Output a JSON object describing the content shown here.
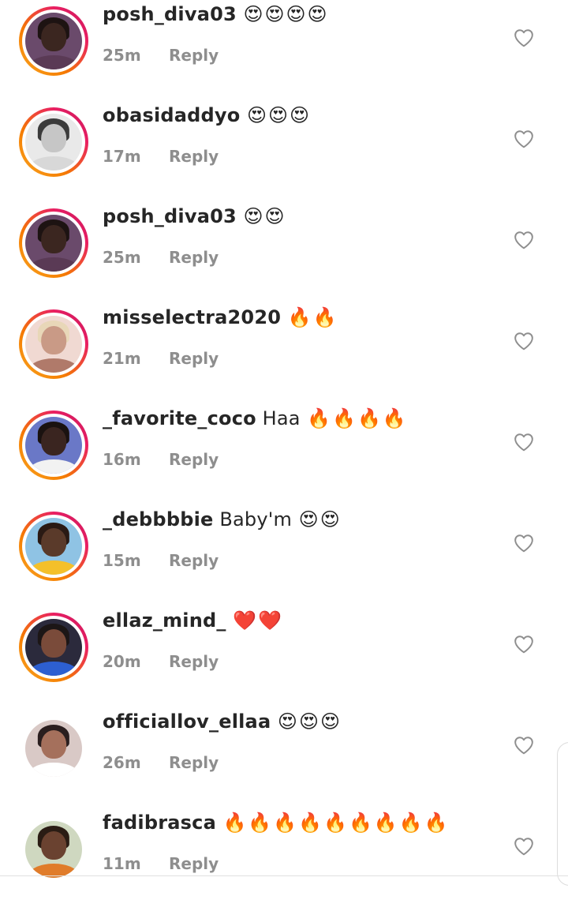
{
  "comments": [
    {
      "username": "posh_diva03",
      "text": "",
      "emojis": "😍😍😍😍",
      "time": "25m",
      "reply": "Reply",
      "story": true,
      "avatar": {
        "bg": "#6a4a6b",
        "skin": "#3b2620",
        "hair": "#1d1312",
        "shirt": "#5a3a55"
      }
    },
    {
      "username": "obasidaddyo",
      "text": "",
      "emojis": "😍😍😍",
      "time": "17m",
      "reply": "Reply",
      "story": true,
      "avatar": {
        "bg": "#e9e9e9",
        "skin": "#c6c6c6",
        "hair": "#3b3b3b",
        "shirt": "#d8d8d8"
      }
    },
    {
      "username": "posh_diva03",
      "text": "",
      "emojis": "😍😍",
      "time": "25m",
      "reply": "Reply",
      "story": true,
      "avatar": {
        "bg": "#6a4a6b",
        "skin": "#3b2620",
        "hair": "#1d1312",
        "shirt": "#5a3a55"
      }
    },
    {
      "username": "misselectra2020",
      "text": "",
      "emojis": "🔥🔥",
      "time": "21m",
      "reply": "Reply",
      "story": true,
      "avatar": {
        "bg": "#f0d9d2",
        "skin": "#c99a86",
        "hair": "#e8d7b8",
        "shirt": "#b07a6a"
      }
    },
    {
      "username": "_favorite_coco",
      "text": " Haa",
      "emojis": "🔥🔥🔥🔥",
      "time": "16m",
      "reply": "Reply",
      "story": true,
      "avatar": {
        "bg": "#6a78c7",
        "skin": "#3a2520",
        "hair": "#1a1210",
        "shirt": "#f2f2f2"
      }
    },
    {
      "username": "_debbbbie",
      "text": " Baby'm",
      "emojis": "😍😍",
      "time": "15m",
      "reply": "Reply",
      "story": true,
      "avatar": {
        "bg": "#8fc3e4",
        "skin": "#5a3a2a",
        "hair": "#2a1a14",
        "shirt": "#f4c02a"
      }
    },
    {
      "username": "ellaz_mind_",
      "text": "",
      "emojis": "❤️❤️",
      "time": "20m",
      "reply": "Reply",
      "story": true,
      "avatar": {
        "bg": "#2b2a3c",
        "skin": "#7a4b3a",
        "hair": "#1c1616",
        "shirt": "#2d5fd1"
      }
    },
    {
      "username": "officiallov_ellaa",
      "text": "",
      "emojis": "😍😍😍",
      "time": "26m",
      "reply": "Reply",
      "story": false,
      "avatar": {
        "bg": "#d9c9c6",
        "skin": "#a5705c",
        "hair": "#2a1e1e",
        "shirt": "#ffffff"
      }
    },
    {
      "username": "fadibrasca",
      "text": "",
      "emojis": "🔥🔥🔥🔥🔥🔥🔥🔥🔥",
      "time": "11m",
      "reply": "Reply",
      "story": false,
      "avatar": {
        "bg": "#cfd8c0",
        "skin": "#6a4230",
        "hair": "#2a1c14",
        "shirt": "#e07c2a"
      }
    }
  ],
  "icons": {
    "like": "heart-outline-icon"
  },
  "colors": {
    "username": "#262626",
    "meta": "#8e8e8e",
    "heart": "#8e8e8e"
  }
}
